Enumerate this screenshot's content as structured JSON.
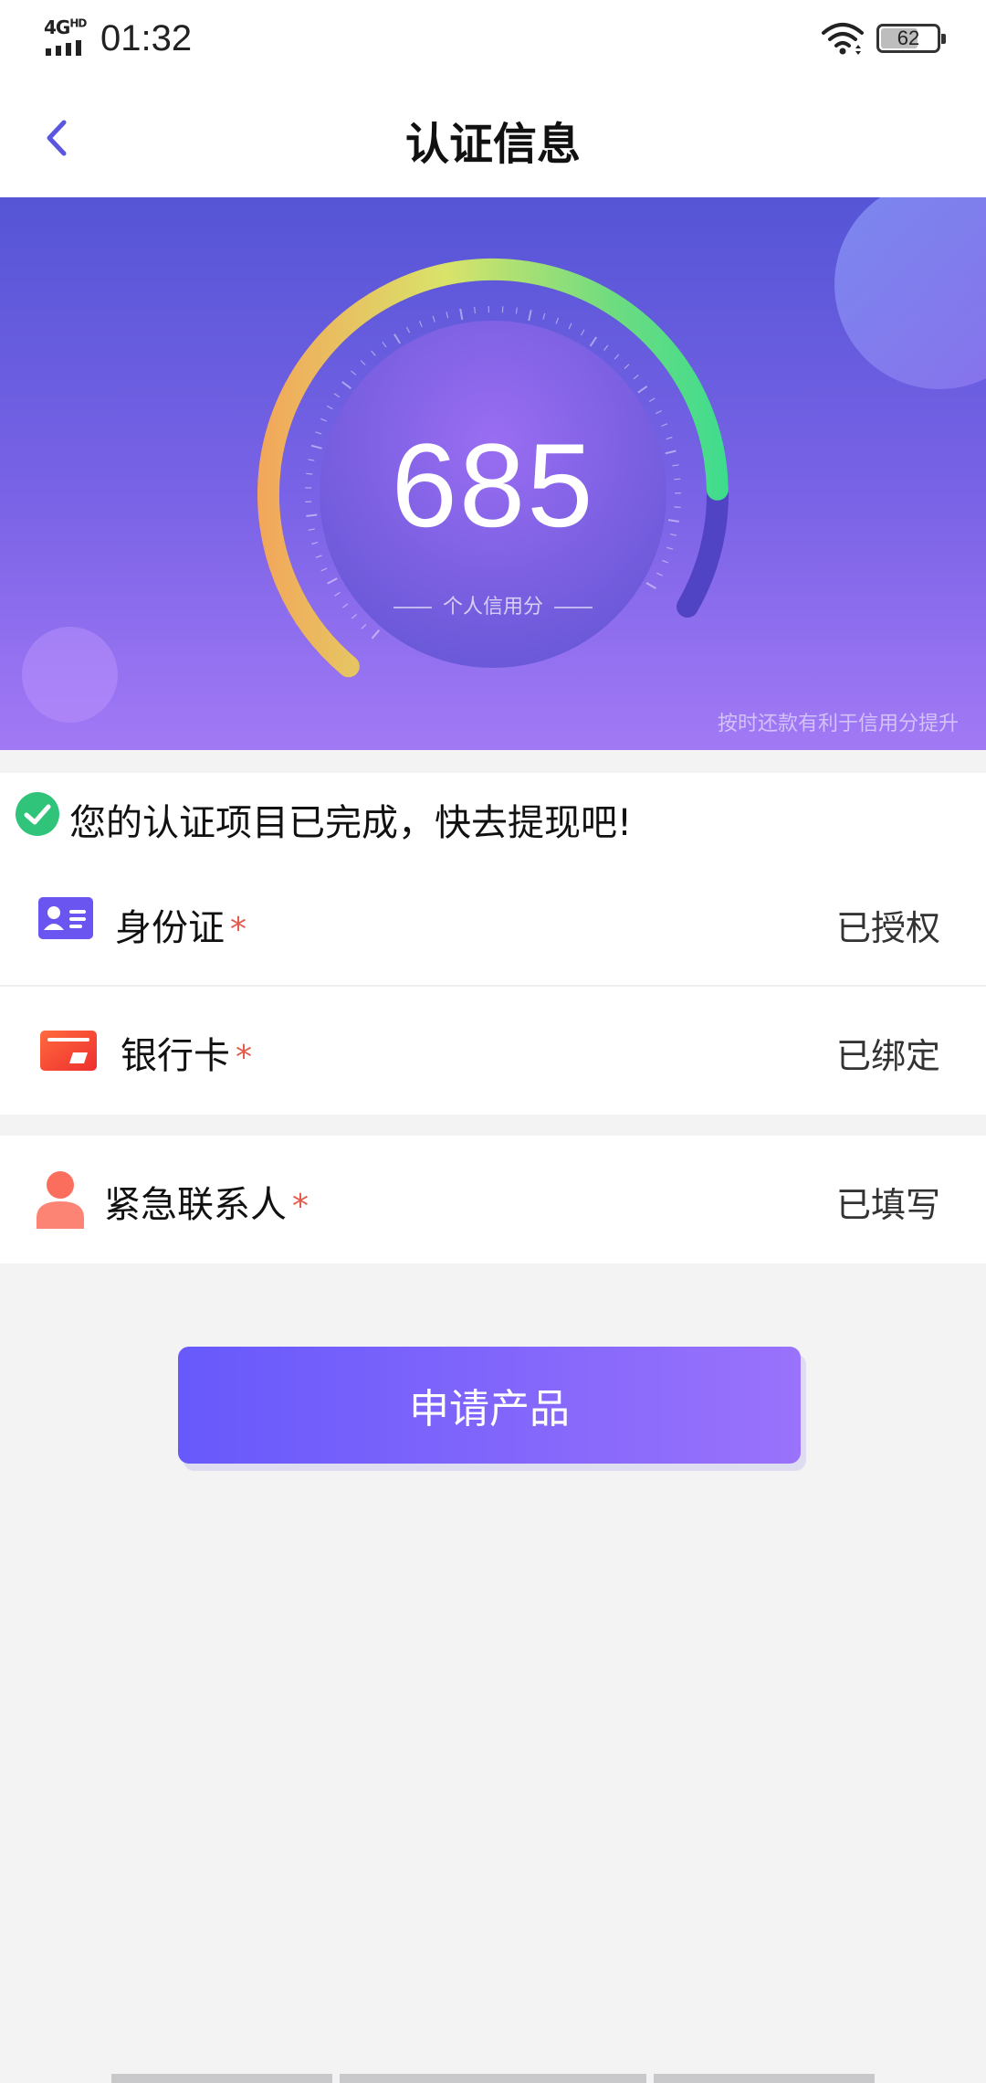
{
  "status_bar": {
    "network": "4G",
    "network_sup": "HD",
    "time": "01:32",
    "battery": "62"
  },
  "nav": {
    "title": "认证信息"
  },
  "credit": {
    "score": "685",
    "label": "个人信用分",
    "tip": "按时还款有利于信用分提升",
    "gauge_level": 0.88
  },
  "notice": {
    "text": "您的认证项目已完成，快去提现吧!"
  },
  "items": [
    {
      "label": "身份证",
      "required": "*",
      "status": "已授权"
    },
    {
      "label": "银行卡",
      "required": "*",
      "status": "已绑定"
    },
    {
      "label": "紧急联系人",
      "required": "*",
      "status": "已填写"
    }
  ],
  "apply_button": {
    "label": "申请产品"
  },
  "colors": {
    "accent": "#6759fb",
    "required": "#e25b4c",
    "success": "#2fc47a",
    "gauge_start": "#f3a55a",
    "gauge_mid": "#d9e36a",
    "gauge_end": "#3ddc8e"
  }
}
